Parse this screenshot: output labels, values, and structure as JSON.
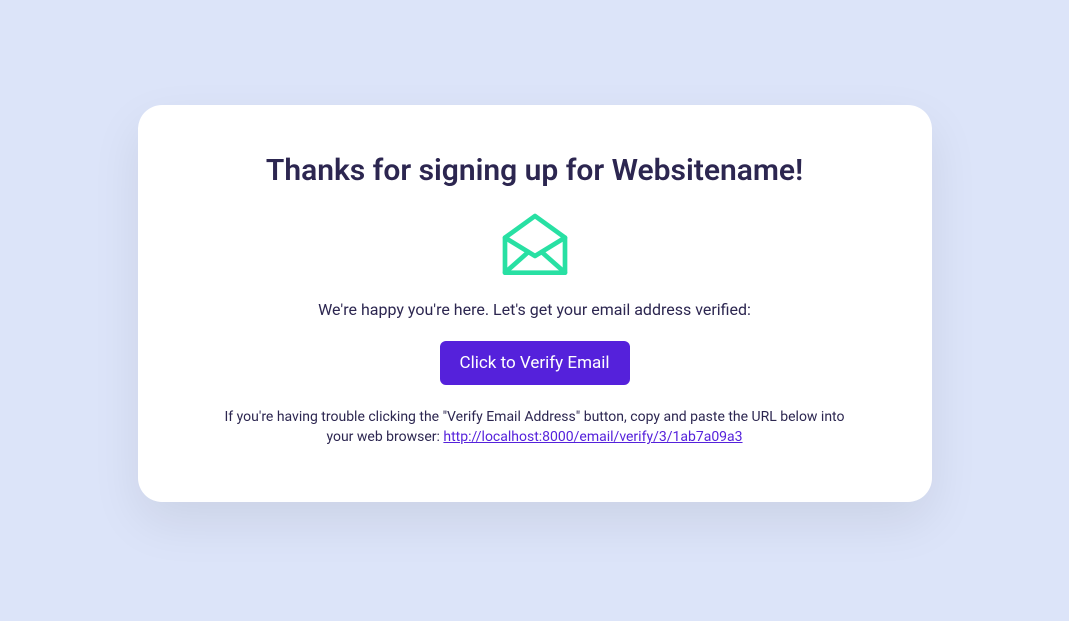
{
  "card": {
    "title": "Thanks for signing up for Websitename!",
    "subtitle": "We're happy you're here. Let's get your email address verified:",
    "button_label": "Click to Verify Email",
    "help_text_prefix": "If you're having trouble clicking the \"Verify Email Address\" button, copy and paste the URL below into your web browser: ",
    "help_link_text": "http://localhost:8000/email/verify/3/1ab7a09a3",
    "help_link_href": "http://localhost:8000/email/verify/3/1ab7a09a3"
  }
}
